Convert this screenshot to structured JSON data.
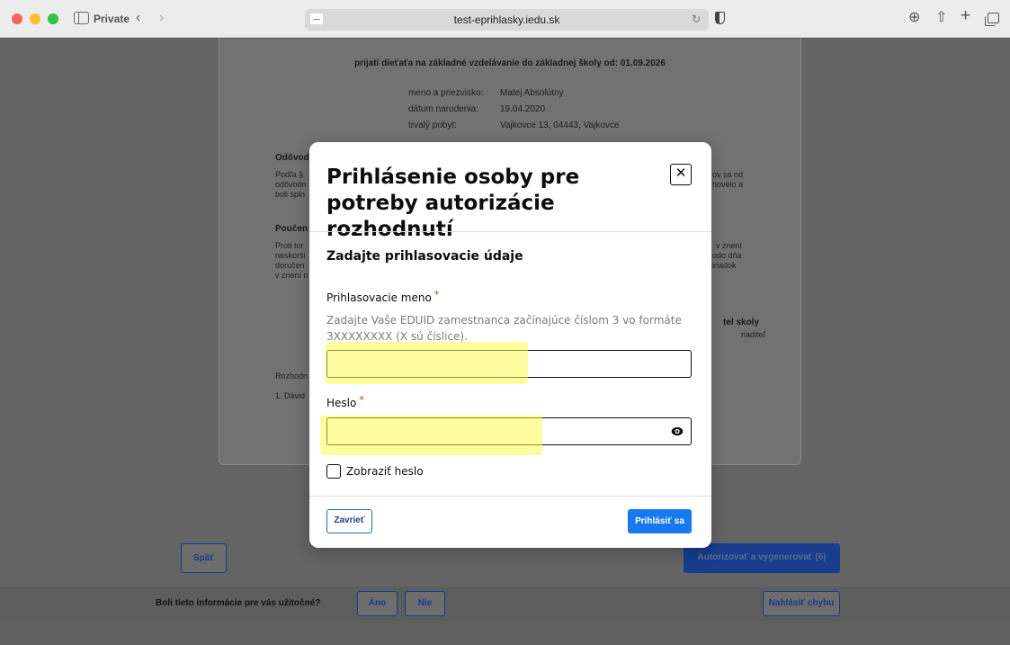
{
  "browser": {
    "mode_label": "Private",
    "url": "test-eprihlasky.iedu.sk",
    "icons": [
      "sidebar-icon",
      "back-arrow-icon",
      "forward-arrow-icon",
      "reload-icon",
      "shield-icon",
      "download-icon",
      "share-icon",
      "new-tab-icon",
      "tab-overview-icon"
    ]
  },
  "document": {
    "title": "prijatí dieťaťa na základné vzdelávanie do základnej školy od: 01.09.2026",
    "fields": [
      {
        "label": "meno a priezvisko:",
        "value": "Matej Absolútny"
      },
      {
        "label": "dátum narodenia:",
        "value": "19.04.2020"
      },
      {
        "label": "trvalý pobyt:",
        "value": "Vajkovce 13, 04443, Vajkovce"
      }
    ],
    "heading_reason": "Odôvod",
    "reason_left": [
      "Podľa §",
      "odôvodn",
      "boli spln"
    ],
    "reason_right": [
      "ov sa od",
      "hovelo a"
    ],
    "heading_instruction": "Poučen",
    "instruction_left": [
      "Proti tor",
      "neskorši",
      "doručen",
      "v znení n"
    ],
    "instruction_right": [
      "v znení",
      "odo dňa",
      "poriadok"
    ],
    "signature_role": "tel skoly",
    "signature_title": "riaditeľ",
    "decision_label": "Rozhodn",
    "list_item": "1. Dávid"
  },
  "footer": {
    "back_button": "Späť",
    "authorize_button": "Autorizovať a vygenerovať (6)",
    "feedback_question": "Boli tieto informácie pre vás užitočné?",
    "yes_button": "Áno",
    "no_button": "Nie",
    "report_button": "Nahlásiť chybu"
  },
  "modal": {
    "title": "Prihlásenie osoby pre potreby autorizácie rozhodnutí",
    "close_symbol": "✕",
    "section_heading": "Zadajte prihlasovacie údaje",
    "username_label": "Prihlasovacie meno",
    "username_hint": "Zadajte Vaše EDUID zamestnanca začínajúce číslom 3 vo formáte 3XXXXXXXX (X sú číslice).",
    "username_value": "",
    "password_label": "Heslo",
    "password_value": "",
    "required_mark": "*",
    "show_password_label": "Zobraziť heslo",
    "show_password_checked": false,
    "close_button": "Zavrieť",
    "login_button": "Prihlásiť sa"
  },
  "colors": {
    "primary": "#1779f0",
    "outline_blue": "#1d70b8",
    "required": "#d4351c",
    "highlight": "#fffa50"
  }
}
